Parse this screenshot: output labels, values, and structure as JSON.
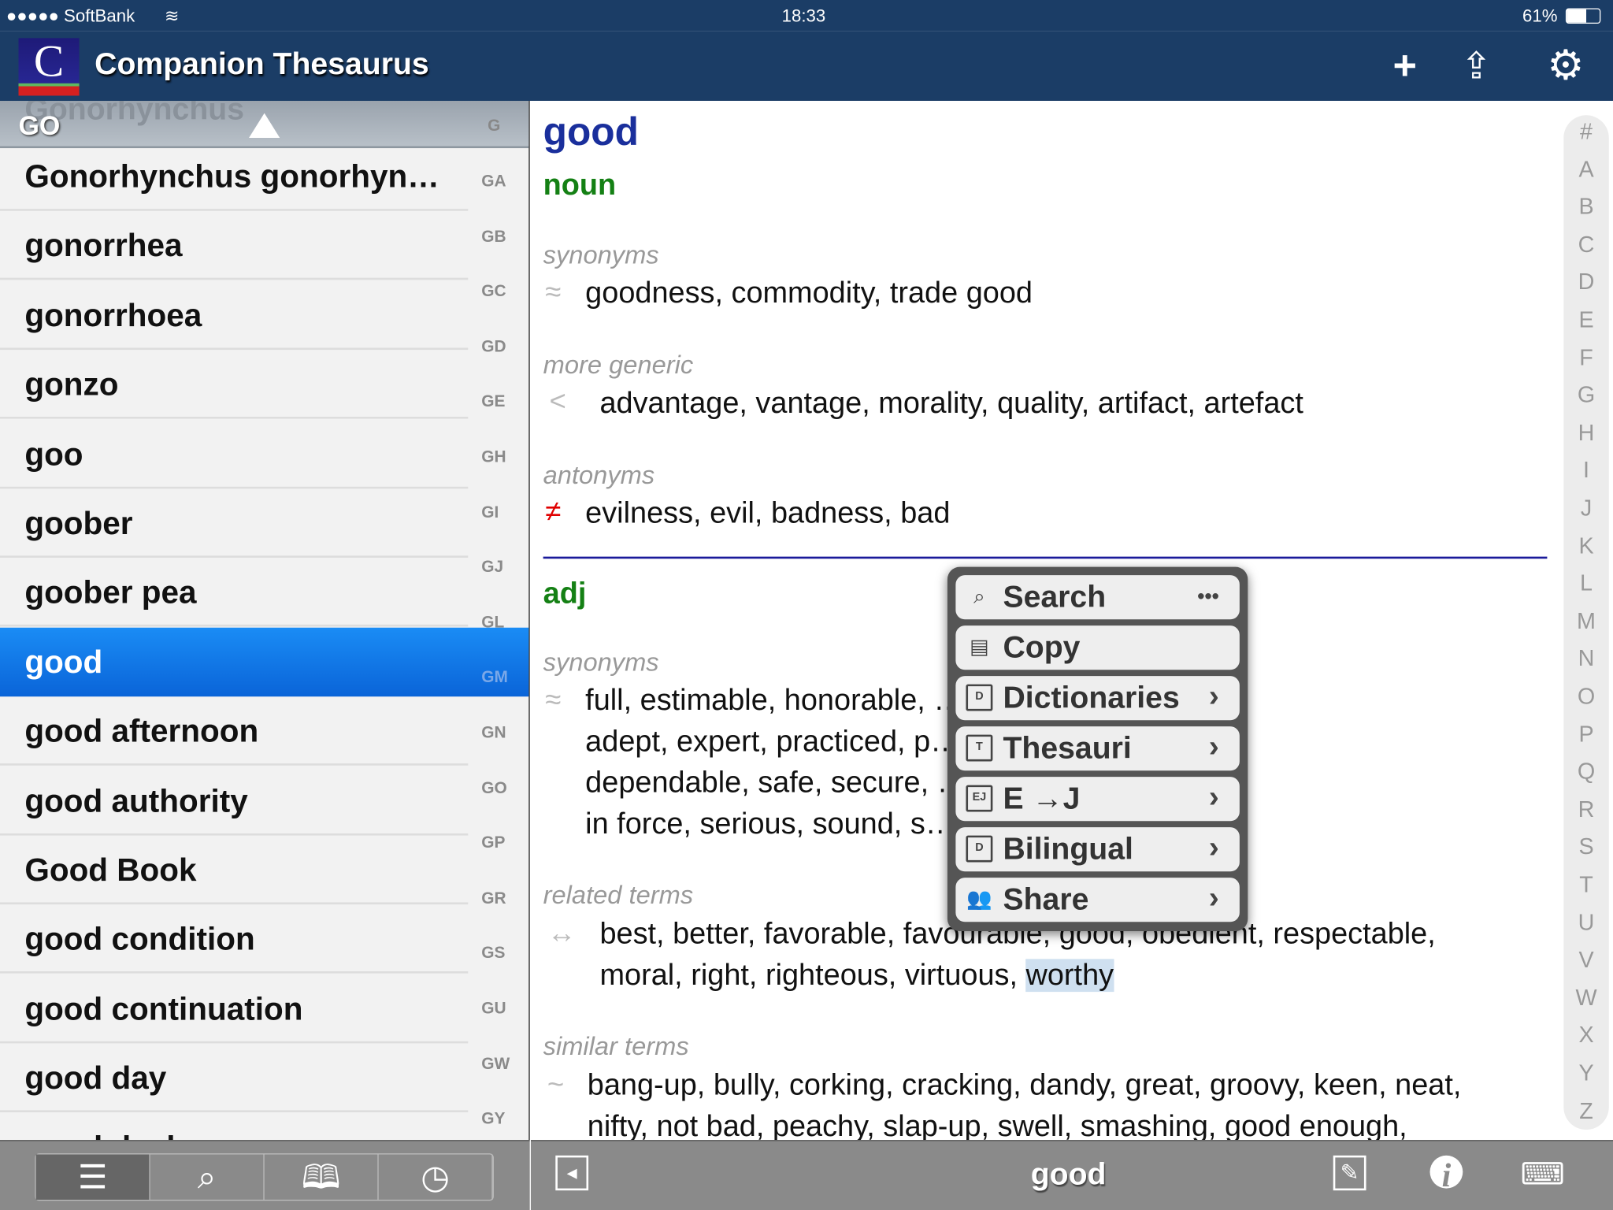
{
  "status": {
    "carrier": "●●●●● SoftBank",
    "time": "18:33",
    "battery": "61%"
  },
  "header": {
    "logo_letter": "C",
    "title": "Companion Thesaurus",
    "icons": [
      "plus-icon",
      "share-icon",
      "gear-icon"
    ]
  },
  "sidebar": {
    "ghost_text": "Gonorhynchus",
    "prefix": "GO",
    "current_section": "G",
    "items": [
      "Gonorhynchus gonorhyn…",
      "gonorrhea",
      "gonorrhoea",
      "gonzo",
      "goo",
      "goober",
      "goober pea",
      "good",
      "good afternoon",
      "good authority",
      "Good Book",
      "good condition",
      "good continuation",
      "good day",
      "good deal"
    ],
    "selected": "good",
    "sections": [
      "GA",
      "GB",
      "GC",
      "GD",
      "GE",
      "GH",
      "GI",
      "GJ",
      "GL",
      "GM",
      "GN",
      "GO",
      "GP",
      "GR",
      "GS",
      "GU",
      "GW",
      "GY"
    ]
  },
  "entry": {
    "word": "good",
    "noun": {
      "pos": "noun",
      "synonyms_label": "synonyms",
      "synonyms": "goodness, commodity, trade good",
      "generic_label": "more generic",
      "generic": "advantage, vantage, morality, quality, artifact, artefact",
      "antonyms_label": "antonyms",
      "antonyms": "evilness, evil, badness, bad"
    },
    "adj": {
      "pos": "adj",
      "synonyms_label": "synonyms",
      "synonyms_lines": [
        "full, estimable, honorable, … al, just, upright,",
        "adept, expert, practiced, p… ul, dear, near,",
        "dependable, safe, secure, … tive, in effect,",
        "in force, serious, sound, s… spoilt"
      ],
      "related_label": "related terms",
      "related_lines": [
        "best, better, favorable, favourable, good, obedient, respectable,",
        "moral, right, righteous, virtuous, "
      ],
      "related_highlight": "worthy",
      "similar_label": "similar terms",
      "similar_lines": [
        "bang-up, bully, corking, cracking, dandy, great, groovy, keen, neat,",
        "nifty, not bad, peachy, slap-up, swell, smashing, good enough,"
      ]
    }
  },
  "index": [
    "#",
    "A",
    "B",
    "C",
    "D",
    "E",
    "F",
    "G",
    "H",
    "I",
    "J",
    "K",
    "L",
    "M",
    "N",
    "O",
    "P",
    "Q",
    "R",
    "S",
    "T",
    "U",
    "V",
    "W",
    "X",
    "Y",
    "Z"
  ],
  "menu": {
    "items": [
      {
        "label": "Search",
        "icon": "search-icon",
        "extra": "•••"
      },
      {
        "label": "Copy",
        "icon": "clipboard-icon"
      },
      {
        "label": "Dictionaries",
        "icon": "book-d-icon",
        "badge": "D"
      },
      {
        "label": "Thesauri",
        "icon": "book-t-icon",
        "badge": "T"
      },
      {
        "label": "E →J",
        "icon": "book-ej-icon",
        "badge": "EJ"
      },
      {
        "label": "Bilingual",
        "icon": "book-d-icon",
        "badge": "D"
      },
      {
        "label": "Share",
        "icon": "people-icon"
      }
    ]
  },
  "bottom": {
    "title": "good",
    "left_tabs": [
      "list-icon",
      "search-icon",
      "book-icon",
      "history-icon"
    ],
    "active_tab": "list-icon"
  },
  "colors": {
    "header": "#1b3d66",
    "selection": "#0a64d8",
    "headword": "#1a2f9c",
    "pos": "#148014",
    "antonym": "#e00000"
  }
}
